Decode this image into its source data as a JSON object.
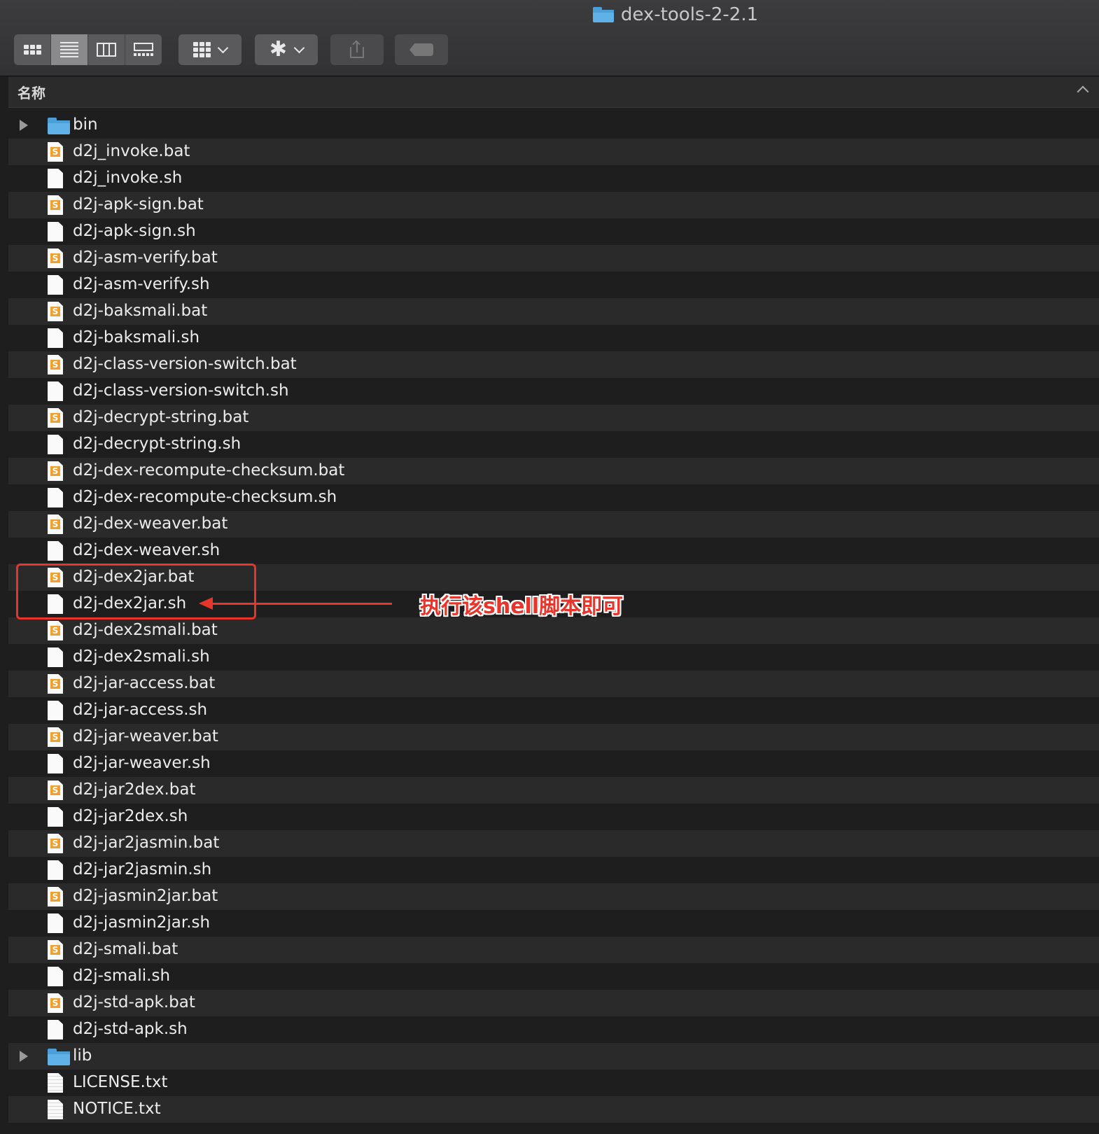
{
  "window": {
    "title": "dex-tools-2-2.1",
    "title_icon": "folder-icon"
  },
  "toolbar": {
    "view_modes": [
      {
        "name": "icon-view",
        "icon": "grid-icon",
        "active": false
      },
      {
        "name": "list-view",
        "icon": "list-icon",
        "active": true
      },
      {
        "name": "column-view",
        "icon": "columns-icon",
        "active": false
      },
      {
        "name": "gallery-view",
        "icon": "gallery-icon",
        "active": false
      }
    ],
    "group_button_icon": "grid-icon",
    "action_button_icon": "gear-icon",
    "share_button_icon": "share-icon",
    "tag_button_icon": "tag-icon"
  },
  "list_header": {
    "name_column": "名称"
  },
  "files": [
    {
      "name": "bin",
      "type": "folder"
    },
    {
      "name": "d2j_invoke.bat",
      "type": "bat"
    },
    {
      "name": "d2j_invoke.sh",
      "type": "sh"
    },
    {
      "name": "d2j-apk-sign.bat",
      "type": "bat"
    },
    {
      "name": "d2j-apk-sign.sh",
      "type": "sh"
    },
    {
      "name": "d2j-asm-verify.bat",
      "type": "bat"
    },
    {
      "name": "d2j-asm-verify.sh",
      "type": "sh"
    },
    {
      "name": "d2j-baksmali.bat",
      "type": "bat"
    },
    {
      "name": "d2j-baksmali.sh",
      "type": "sh"
    },
    {
      "name": "d2j-class-version-switch.bat",
      "type": "bat"
    },
    {
      "name": "d2j-class-version-switch.sh",
      "type": "sh"
    },
    {
      "name": "d2j-decrypt-string.bat",
      "type": "bat"
    },
    {
      "name": "d2j-decrypt-string.sh",
      "type": "sh"
    },
    {
      "name": "d2j-dex-recompute-checksum.bat",
      "type": "bat"
    },
    {
      "name": "d2j-dex-recompute-checksum.sh",
      "type": "sh"
    },
    {
      "name": "d2j-dex-weaver.bat",
      "type": "bat"
    },
    {
      "name": "d2j-dex-weaver.sh",
      "type": "sh"
    },
    {
      "name": "d2j-dex2jar.bat",
      "type": "bat"
    },
    {
      "name": "d2j-dex2jar.sh",
      "type": "sh"
    },
    {
      "name": "d2j-dex2smali.bat",
      "type": "bat"
    },
    {
      "name": "d2j-dex2smali.sh",
      "type": "sh"
    },
    {
      "name": "d2j-jar-access.bat",
      "type": "bat"
    },
    {
      "name": "d2j-jar-access.sh",
      "type": "sh"
    },
    {
      "name": "d2j-jar-weaver.bat",
      "type": "bat"
    },
    {
      "name": "d2j-jar-weaver.sh",
      "type": "sh"
    },
    {
      "name": "d2j-jar2dex.bat",
      "type": "bat"
    },
    {
      "name": "d2j-jar2dex.sh",
      "type": "sh"
    },
    {
      "name": "d2j-jar2jasmin.bat",
      "type": "bat"
    },
    {
      "name": "d2j-jar2jasmin.sh",
      "type": "sh"
    },
    {
      "name": "d2j-jasmin2jar.bat",
      "type": "bat"
    },
    {
      "name": "d2j-jasmin2jar.sh",
      "type": "sh"
    },
    {
      "name": "d2j-smali.bat",
      "type": "bat"
    },
    {
      "name": "d2j-smali.sh",
      "type": "sh"
    },
    {
      "name": "d2j-std-apk.bat",
      "type": "bat"
    },
    {
      "name": "d2j-std-apk.sh",
      "type": "sh"
    },
    {
      "name": "lib",
      "type": "folder"
    },
    {
      "name": "LICENSE.txt",
      "type": "txt"
    },
    {
      "name": "NOTICE.txt",
      "type": "txt"
    }
  ],
  "annotation": {
    "text": "执行该shell脚本即可",
    "color": "#e8352b"
  }
}
